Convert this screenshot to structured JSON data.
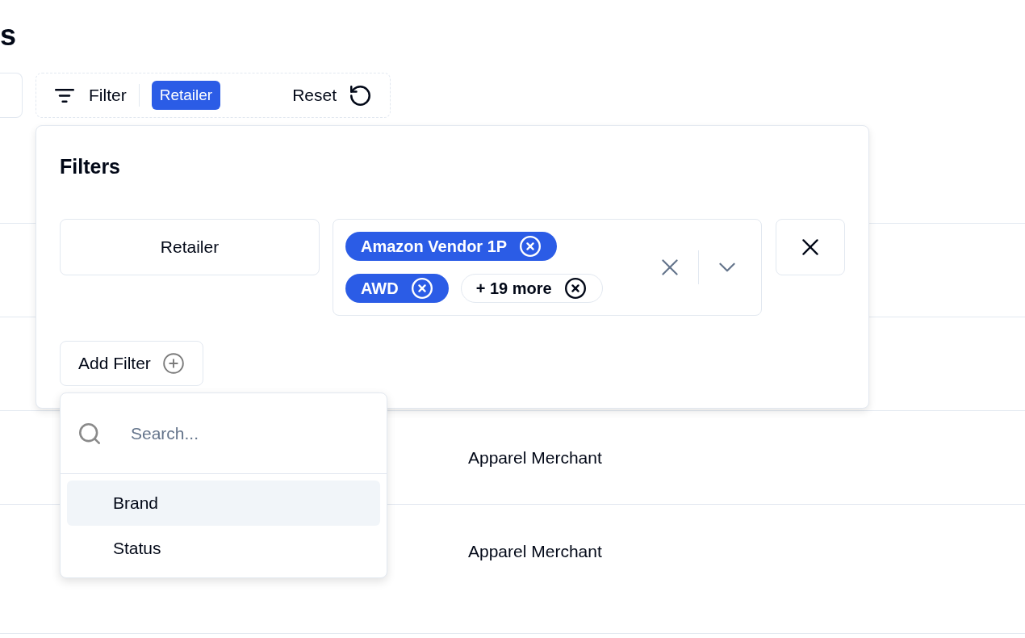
{
  "page": {
    "heading": "s"
  },
  "toolbar": {
    "filter_button": {
      "label": "Filter"
    },
    "applied_filters": [
      {
        "label": "Retailer"
      }
    ],
    "reset_button": {
      "label": "Reset"
    }
  },
  "filters_panel": {
    "title": "Filters",
    "rows": [
      {
        "field": "Retailer",
        "values": [
          {
            "kind": "value",
            "label": "Amazon Vendor 1P"
          },
          {
            "kind": "value",
            "label": "AWD"
          },
          {
            "kind": "overflow",
            "label": "+ 19 more"
          }
        ]
      }
    ],
    "add_filter_button": {
      "label": "Add Filter"
    }
  },
  "add_filter_menu": {
    "search": {
      "placeholder": "Search..."
    },
    "items": [
      {
        "label": "Brand",
        "selected": true
      },
      {
        "label": "Status",
        "selected": false
      }
    ]
  },
  "table": {
    "rows": [
      {
        "column_2": "Apparel Merchant"
      },
      {
        "column_2": "Apparel Merchant"
      }
    ]
  }
}
